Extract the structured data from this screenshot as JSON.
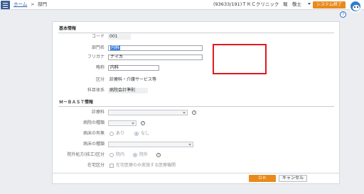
{
  "header": {
    "home_link": "ホーム",
    "separator": ">",
    "current_page": "部門",
    "company": "(93633/191)ＴＫＣクリニック",
    "user": "堀　敬士",
    "exit_label": "システム終了",
    "help_icon": "?"
  },
  "basic": {
    "title": "基本情報",
    "code_label": "コード",
    "code_value": "001",
    "dept_name_label": "部門名",
    "dept_name_value": "内科",
    "furigana_label": "フリガナ",
    "furigana_value": "ナイカ",
    "short_name_label": "略称",
    "short_name_value": "内科",
    "category_label": "区分",
    "category_value": "診療科・介護サービス等",
    "account_system_label": "科目体系",
    "account_system_value": "病院会計準則"
  },
  "mbast": {
    "title": "Ｍ－ＢＡＳＴ情報",
    "dept_label": "診療科",
    "ward_type_label": "病院の種類",
    "bed_presence_label": "病床の有無",
    "bed_yes": "あり",
    "bed_no": "なし",
    "bed_type_label": "病床の種類",
    "outside_rx_label": "院外処方(技工)区分",
    "in_hospital": "院内",
    "out_hospital": "院外",
    "home_care_label": "在宅区分",
    "home_care_option": "在宅医療のみ実施する医療機関"
  },
  "footer": {
    "ok_label": "ＯＫ",
    "cancel_label": "キャンセル"
  }
}
